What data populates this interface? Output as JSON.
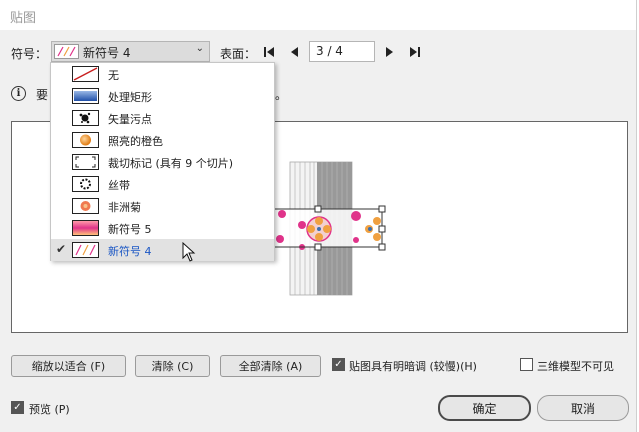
{
  "window": {
    "title": "贴图"
  },
  "symbol": {
    "label": "符号：",
    "selected": "新符号 4"
  },
  "surface": {
    "label": "表面：",
    "page": "3 / 4"
  },
  "info": {
    "text": "要",
    "tail": "。"
  },
  "dropdown": {
    "items": [
      {
        "label": "无",
        "icon": "none-slash-icon"
      },
      {
        "label": "处理矩形",
        "icon": "blue-gradient-rect-icon"
      },
      {
        "label": "矢量污点",
        "icon": "ink-splat-icon"
      },
      {
        "label": "照亮的橙色",
        "icon": "orange-sphere-icon"
      },
      {
        "label": "裁切标记 (具有 9 个切片)",
        "icon": "crop-marks-icon"
      },
      {
        "label": "丝带",
        "icon": "ribbon-icon"
      },
      {
        "label": "非洲菊",
        "icon": "gerbera-icon"
      },
      {
        "label": "新符号 5",
        "icon": "pink-gradient-icon"
      },
      {
        "label": "新符号 4",
        "icon": "pattern-icon",
        "checked": true
      }
    ]
  },
  "buttons": {
    "fit": "缩放以适合 (F)",
    "clear": "清除 (C)",
    "clear_all": "全部清除 (A)",
    "ok": "确定",
    "cancel": "取消"
  },
  "options": {
    "shade": {
      "label": "贴图具有明暗调 (较慢)(H)",
      "checked": true
    },
    "invisible": {
      "label": "三维模型不可见",
      "checked": false
    },
    "preview": {
      "label": "预览 (P)",
      "checked": true
    }
  },
  "colors": {
    "accent": "#1a56c4",
    "pink": "#e0338a",
    "orange": "#f0a040"
  }
}
